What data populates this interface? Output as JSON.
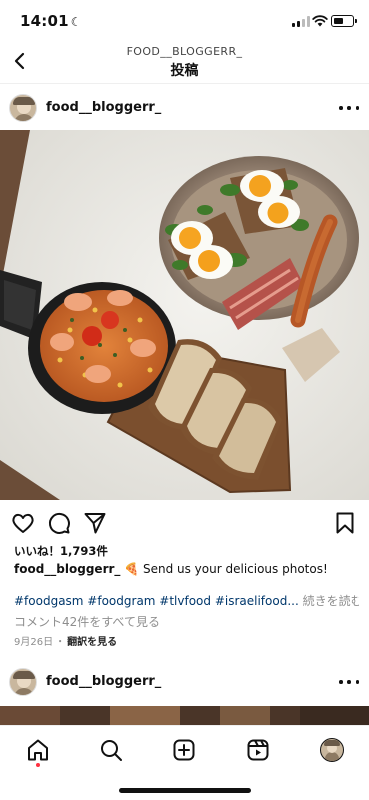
{
  "status": {
    "time": "14:01",
    "moon_icon": "moon-icon",
    "battery_level": 0.55
  },
  "header": {
    "account": "FOOD__BLOGGERR_",
    "title": "投稿",
    "back_icon": "chevron-left-icon"
  },
  "post": {
    "username": "food__bloggerr_",
    "likes": "いいね！1,793件",
    "caption_user": "food__bloggerr_",
    "caption_text": " 🍕 Send us your delicious photos!",
    "hashtags": "#foodgasm #foodgram #tlvfood #israelifood...",
    "more": " 続きを読む",
    "comments": "コメント42件をすべて見る",
    "date": "9月26日",
    "dot": "・",
    "translate": "翻訳を見る",
    "icons": [
      "heart-icon",
      "comment-icon",
      "share-icon",
      "bookmark-icon"
    ]
  },
  "next_post": {
    "username": "food__bloggerr_"
  },
  "tabbar": {
    "icons": [
      "home-icon",
      "search-icon",
      "create-icon",
      "reels-icon",
      "profile-avatar"
    ],
    "active": "home-icon",
    "notification_color": "#ff3040"
  }
}
